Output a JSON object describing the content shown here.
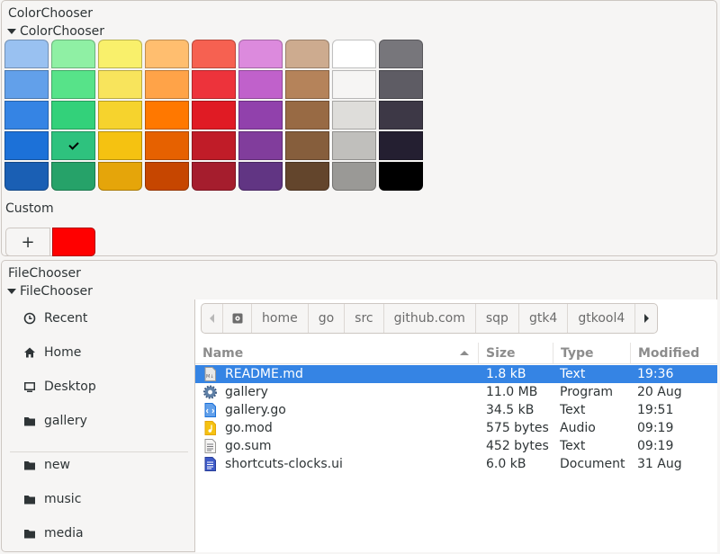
{
  "color_chooser": {
    "frame_title": "ColorChooser",
    "expander_label": "ColorChooser",
    "palette": [
      [
        "#99c1f1",
        "#62a0ea",
        "#3584e4",
        "#1c71d8",
        "#1a5fb4"
      ],
      [
        "#8ff0a4",
        "#57e389",
        "#33d17a",
        "#2ec27e",
        "#26a269"
      ],
      [
        "#f9f06b",
        "#f8e45c",
        "#f6d32d",
        "#f5c211",
        "#e5a50a"
      ],
      [
        "#ffbe6f",
        "#ffa348",
        "#ff7800",
        "#e66100",
        "#c64600"
      ],
      [
        "#f66151",
        "#ed333b",
        "#e01b24",
        "#c01c28",
        "#a51d2d"
      ],
      [
        "#dc8add",
        "#c061cb",
        "#9141ac",
        "#813d9c",
        "#613583"
      ],
      [
        "#cdab8f",
        "#b5835a",
        "#986a44",
        "#865e3c",
        "#63452c"
      ],
      [
        "#ffffff",
        "#f6f5f4",
        "#deddda",
        "#c0bfbc",
        "#9a9996"
      ],
      [
        "#77767b",
        "#5e5c64",
        "#3d3846",
        "#241f31",
        "#000000"
      ]
    ],
    "selected": {
      "column": 1,
      "row": 3
    },
    "selected_icon": "checkmark-icon",
    "custom_label": "Custom",
    "add_label": "+",
    "custom_color": "#ff0000"
  },
  "file_chooser": {
    "frame_title": "FileChooser",
    "expander_label": "FileChooser",
    "places": [
      {
        "label": "Recent",
        "icon": "clock-icon"
      },
      {
        "label": "Home",
        "icon": "home-icon"
      },
      {
        "label": "Desktop",
        "icon": "desktop-icon"
      },
      {
        "label": "gallery",
        "icon": "folder-icon"
      }
    ],
    "bookmarks": [
      {
        "label": "new",
        "icon": "folder-icon"
      },
      {
        "label": "music",
        "icon": "folder-icon"
      },
      {
        "label": "media",
        "icon": "folder-icon"
      }
    ],
    "path": [
      "home",
      "go",
      "src",
      "github.com",
      "sqp",
      "gtk4",
      "gtkool4"
    ],
    "columns": {
      "name": "Name",
      "size": "Size",
      "type": "Type",
      "modified": "Modified"
    },
    "files": [
      {
        "name": "README.md",
        "size": "1.8 kB",
        "type": "Text",
        "modified": "19:36",
        "icon": "markdown-file-icon",
        "selected": true
      },
      {
        "name": "gallery",
        "size": "11.0 MB",
        "type": "Program",
        "modified": "20 Aug",
        "icon": "executable-gear-icon",
        "selected": false
      },
      {
        "name": "gallery.go",
        "size": "34.5 kB",
        "type": "Text",
        "modified": "19:51",
        "icon": "source-code-file-icon",
        "selected": false
      },
      {
        "name": "go.mod",
        "size": "575 bytes",
        "type": "Audio",
        "modified": "09:19",
        "icon": "audio-file-icon",
        "selected": false
      },
      {
        "name": "go.sum",
        "size": "452 bytes",
        "type": "Text",
        "modified": "09:19",
        "icon": "text-file-icon",
        "selected": false
      },
      {
        "name": "shortcuts-clocks.ui",
        "size": "6.0 kB",
        "type": "Document",
        "modified": "31 Aug",
        "icon": "document-file-icon",
        "selected": false
      }
    ],
    "accent_color": "#3584e4"
  }
}
